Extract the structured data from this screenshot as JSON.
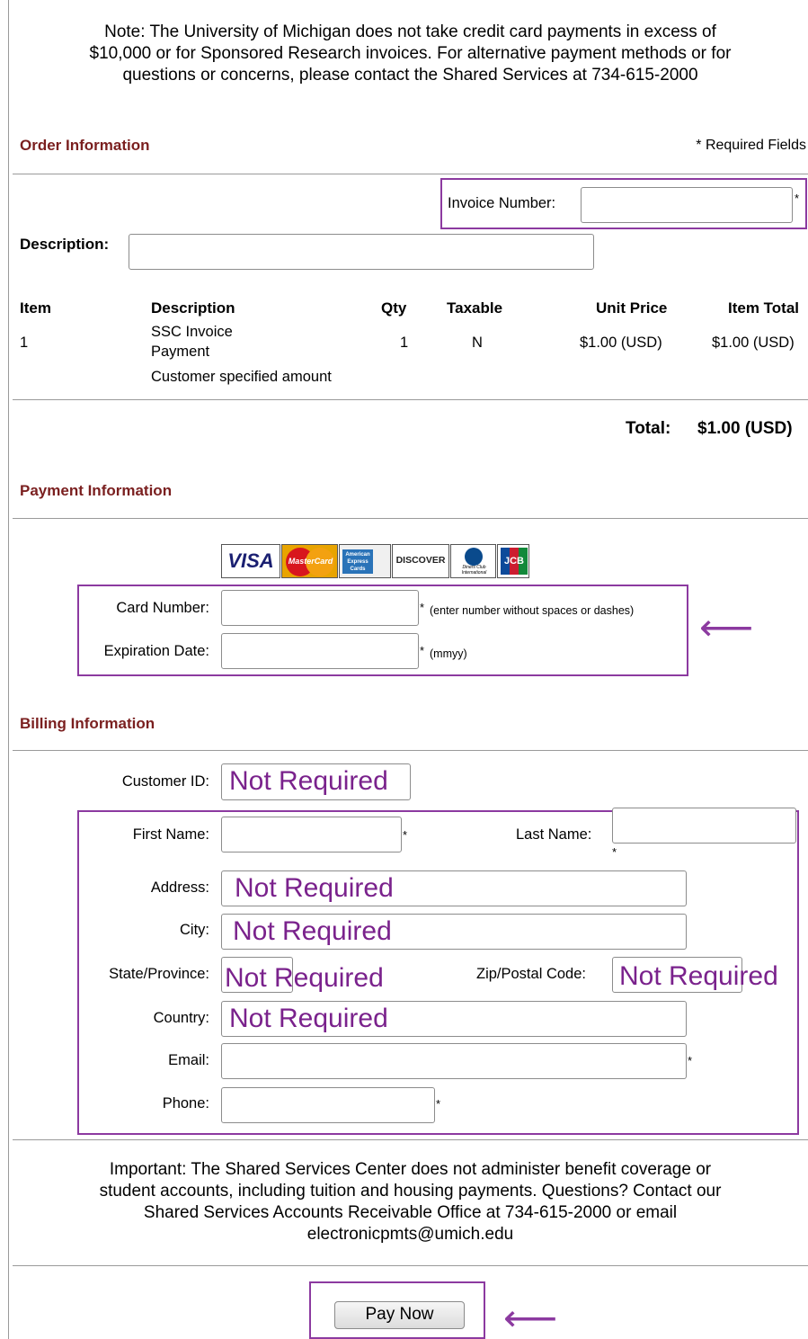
{
  "notes": {
    "top_line1": "Note: The University of Michigan does not take credit card payments in excess of",
    "top_line2": "$10,000 or for Sponsored Research invoices. For alternative payment methods or for",
    "top_line3": "questions or concerns, please contact the Shared Services at 734-615-2000",
    "bottom_line1": "Important: The Shared Services Center does not administer benefit coverage or",
    "bottom_line2": "student accounts, including tuition and housing payments. Questions? Contact our",
    "bottom_line3": "Shared Services Accounts Receivable Office at 734-615-2000 or email",
    "bottom_line4": "electronicpmts@umich.edu"
  },
  "order": {
    "title": "Order Information",
    "required_note": "* Required Fields",
    "invoice_label": "Invoice Number:",
    "invoice_value": "",
    "description_label": "Description:",
    "description_value": "",
    "columns": [
      "Item",
      "Description",
      "Qty",
      "Taxable",
      "Unit Price",
      "Item Total"
    ],
    "row": {
      "item": "1",
      "desc_line1": "SSC Invoice",
      "desc_line2": "Payment",
      "desc_line3": "Customer specified amount",
      "qty": "1",
      "taxable": "N",
      "unit_price": "$1.00 (USD)",
      "item_total": "$1.00 (USD)"
    },
    "total_label": "Total:",
    "total_value": "$1.00 (USD)"
  },
  "payment": {
    "title": "Payment Information",
    "card_logos": [
      "VISA",
      "MasterCard",
      "American Express Cards",
      "DISCOVER",
      "Diners Club International",
      "JCB"
    ],
    "card_number_label": "Card Number:",
    "card_number_value": "",
    "card_number_hint": "(enter number without spaces or dashes)",
    "expiration_label": "Expiration Date:",
    "expiration_value": "",
    "expiration_hint": "(mmyy)"
  },
  "billing": {
    "title": "Billing Information",
    "customer_id_label": "Customer ID:",
    "first_name_label": "First Name:",
    "last_name_label": "Last Name:",
    "address_label": "Address:",
    "city_label": "City:",
    "state_label": "State/Province:",
    "zip_label": "Zip/Postal Code:",
    "country_label": "Country:",
    "email_label": "Email:",
    "phone_label": "Phone:"
  },
  "annotations": {
    "not_required": "Not Required",
    "required_star": "*",
    "arrow": "⟵"
  },
  "actions": {
    "pay_now": "Pay Now"
  },
  "colors": {
    "section_title": "#7a1f1f",
    "annotation": "#8c3aa0",
    "annotation_text": "#7a228c"
  }
}
